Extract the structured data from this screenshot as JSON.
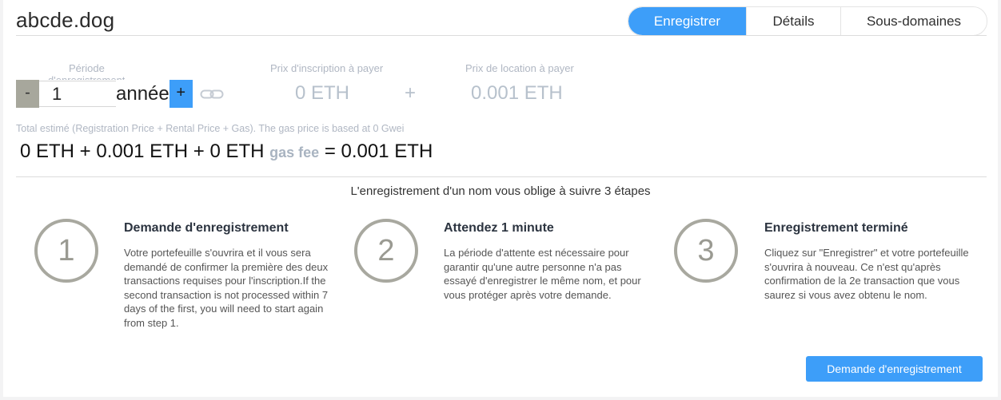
{
  "domain": "abcde.dog",
  "tabs": [
    "Enregistrer",
    "Détails",
    "Sous-domaines"
  ],
  "period": {
    "label": "Période",
    "sublabel": "d'enregistrement",
    "minus": "-",
    "value": "1",
    "unit": "année",
    "plus": "+"
  },
  "prices": {
    "registration_label": "Prix d'inscription à payer",
    "registration_value": "0 ETH",
    "plus_sign": "+",
    "rental_label": "Prix de location à payer",
    "rental_value": "0.001 ETH"
  },
  "total": {
    "label": "Total estimé (Registration Price + Rental Price + Gas). The gas price is based at 0 Gwei",
    "expression": "0 ETH + 0.001 ETH + 0 ETH",
    "gas_label": "gas fee",
    "result": "= 0.001 ETH"
  },
  "steps_title": "L'enregistrement d'un nom vous oblige à suivre 3 étapes",
  "steps": [
    {
      "number": "1",
      "title": "Demande d'enregistrement",
      "text": "Votre portefeuille s'ouvrira et il vous sera demandé de confirmer la première des deux transactions requises pour l'inscription.If the second transaction is not processed within 7 days of the first, you will need to start again from step 1."
    },
    {
      "number": "2",
      "title": "Attendez 1 minute",
      "text": "La période d'attente est nécessaire pour garantir qu'une autre personne n'a pas essayé d'enregistrer le même nom, et pour vous protéger après votre demande."
    },
    {
      "number": "3",
      "title": "Enregistrement terminé",
      "text": "Cliquez sur \"Enregistrer\" et votre portefeuille s'ouvrira à nouveau. Ce n'est qu'après confirmation de la 2e transaction que vous saurez si vous avez obtenu le nom."
    }
  ],
  "cta_label": "Demande d'enregistrement",
  "colors": {
    "accent": "#3d9ef9",
    "circle": "#a8a89f",
    "muted": "#b0b7c3"
  },
  "icons": {
    "link": "link-icon"
  }
}
